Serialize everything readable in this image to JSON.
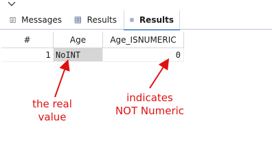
{
  "tabs": [
    {
      "label": "Messages",
      "icon": "messages-icon",
      "active": false
    },
    {
      "label": "Results",
      "icon": "results-grid-icon",
      "active": false
    },
    {
      "label": "Results",
      "icon": "results-grid-icon",
      "active": true
    }
  ],
  "grid": {
    "columns": [
      "#",
      "Age",
      "Age_ISNUMERIC"
    ],
    "rows": [
      {
        "num": "1",
        "age": "NoINT",
        "age_isnumeric": "0"
      }
    ]
  },
  "annotations": {
    "left_line1": "the real",
    "left_line2": "value",
    "right_line1": "indicates",
    "right_line2": "NOT Numeric"
  },
  "colors": {
    "annotation": "#e01010",
    "active_tab_underline": "#1f6cc7"
  }
}
